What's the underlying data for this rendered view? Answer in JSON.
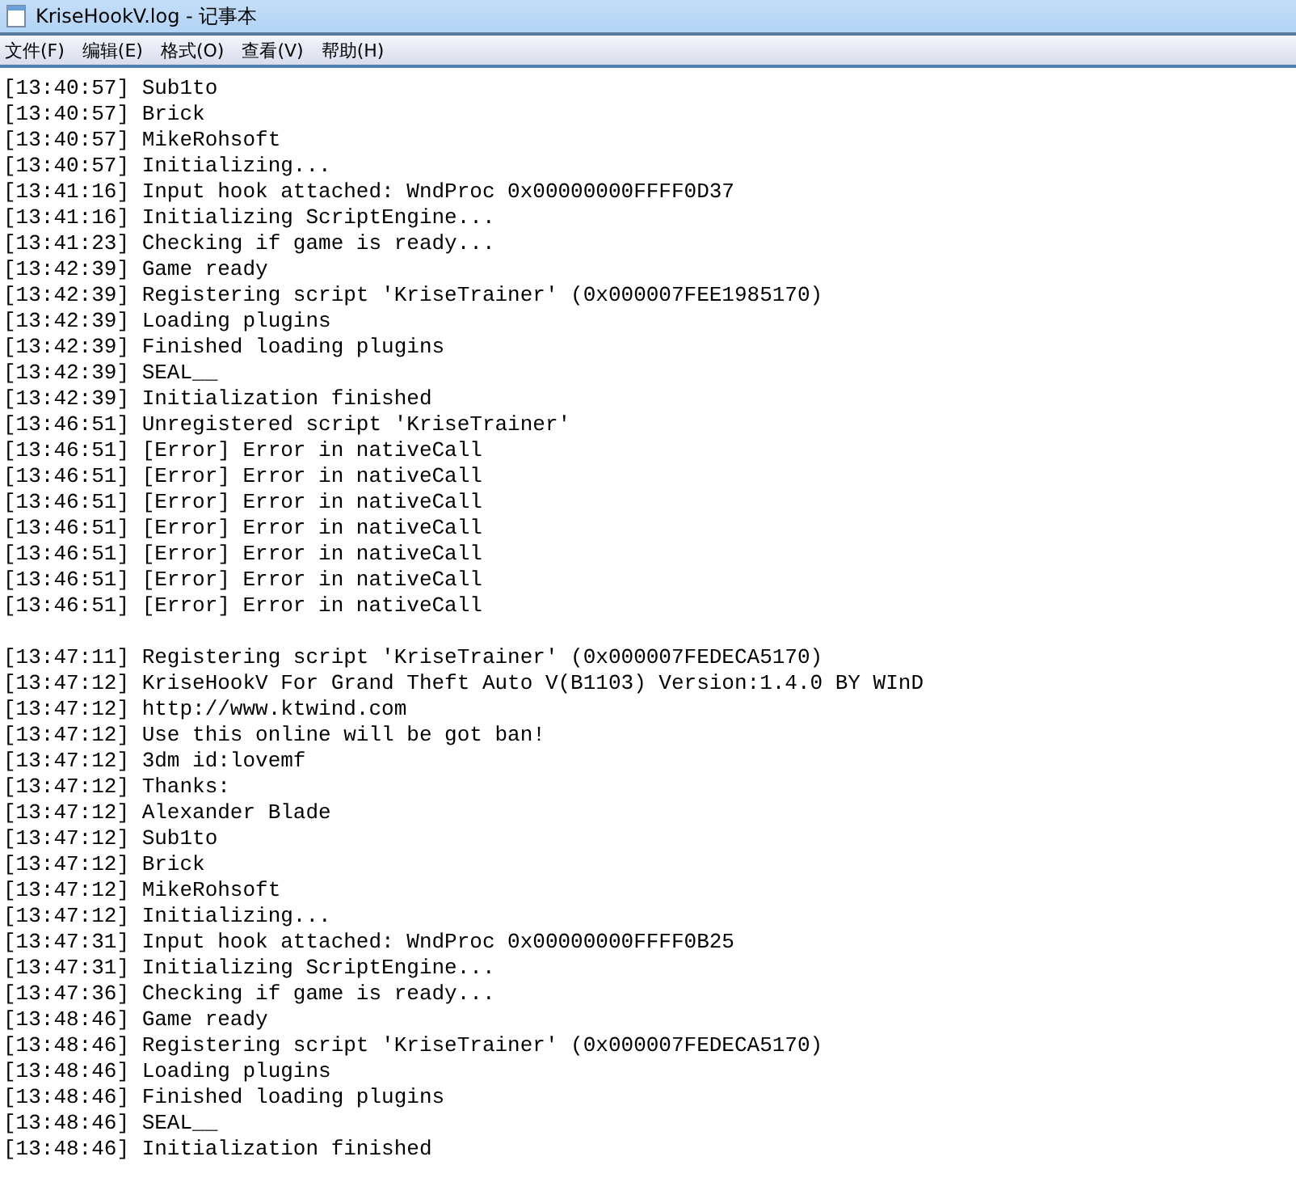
{
  "window": {
    "title": "KriseHookV.log - 记事本"
  },
  "menu": [
    "文件(F)",
    "编辑(E)",
    "格式(O)",
    "查看(V)",
    "帮助(H)"
  ],
  "blocks": [
    {
      "lines": [
        "[13:40:57] Sub1to",
        "[13:40:57] Brick",
        "[13:40:57] MikeRohsoft",
        "[13:40:57] Initializing...",
        "[13:41:16] Input hook attached: WndProc 0x00000000FFFF0D37",
        "[13:41:16] Initializing ScriptEngine...",
        "[13:41:23] Checking if game is ready...",
        "[13:42:39] Game ready",
        "[13:42:39] Registering script 'KriseTrainer' (0x000007FEE1985170)",
        "[13:42:39] Loading plugins",
        "[13:42:39] Finished loading plugins",
        "[13:42:39] SEAL__",
        "[13:42:39] Initialization finished",
        "[13:46:51] Unregistered script 'KriseTrainer'",
        "[13:46:51] [Error] Error in nativeCall",
        "[13:46:51] [Error] Error in nativeCall",
        "[13:46:51] [Error] Error in nativeCall",
        "[13:46:51] [Error] Error in nativeCall",
        "[13:46:51] [Error] Error in nativeCall",
        "[13:46:51] [Error] Error in nativeCall",
        "[13:46:51] [Error] Error in nativeCall"
      ]
    },
    {
      "lines": [
        "[13:47:11] Registering script 'KriseTrainer' (0x000007FEDECA5170)",
        "[13:47:12] KriseHookV For Grand Theft Auto V(B1103) Version:1.4.0 BY WInD",
        "[13:47:12] http://www.ktwind.com",
        "[13:47:12] Use this online will be got ban!",
        "[13:47:12] 3dm id:lovemf",
        "[13:47:12] Thanks:",
        "[13:47:12] Alexander Blade",
        "[13:47:12] Sub1to",
        "[13:47:12] Brick",
        "[13:47:12] MikeRohsoft",
        "[13:47:12] Initializing...",
        "[13:47:31] Input hook attached: WndProc 0x00000000FFFF0B25",
        "[13:47:31] Initializing ScriptEngine...",
        "[13:47:36] Checking if game is ready...",
        "[13:48:46] Game ready",
        "[13:48:46] Registering script 'KriseTrainer' (0x000007FEDECA5170)",
        "[13:48:46] Loading plugins",
        "[13:48:46] Finished loading plugins",
        "[13:48:46] SEAL__",
        "[13:48:46] Initialization finished"
      ]
    }
  ]
}
